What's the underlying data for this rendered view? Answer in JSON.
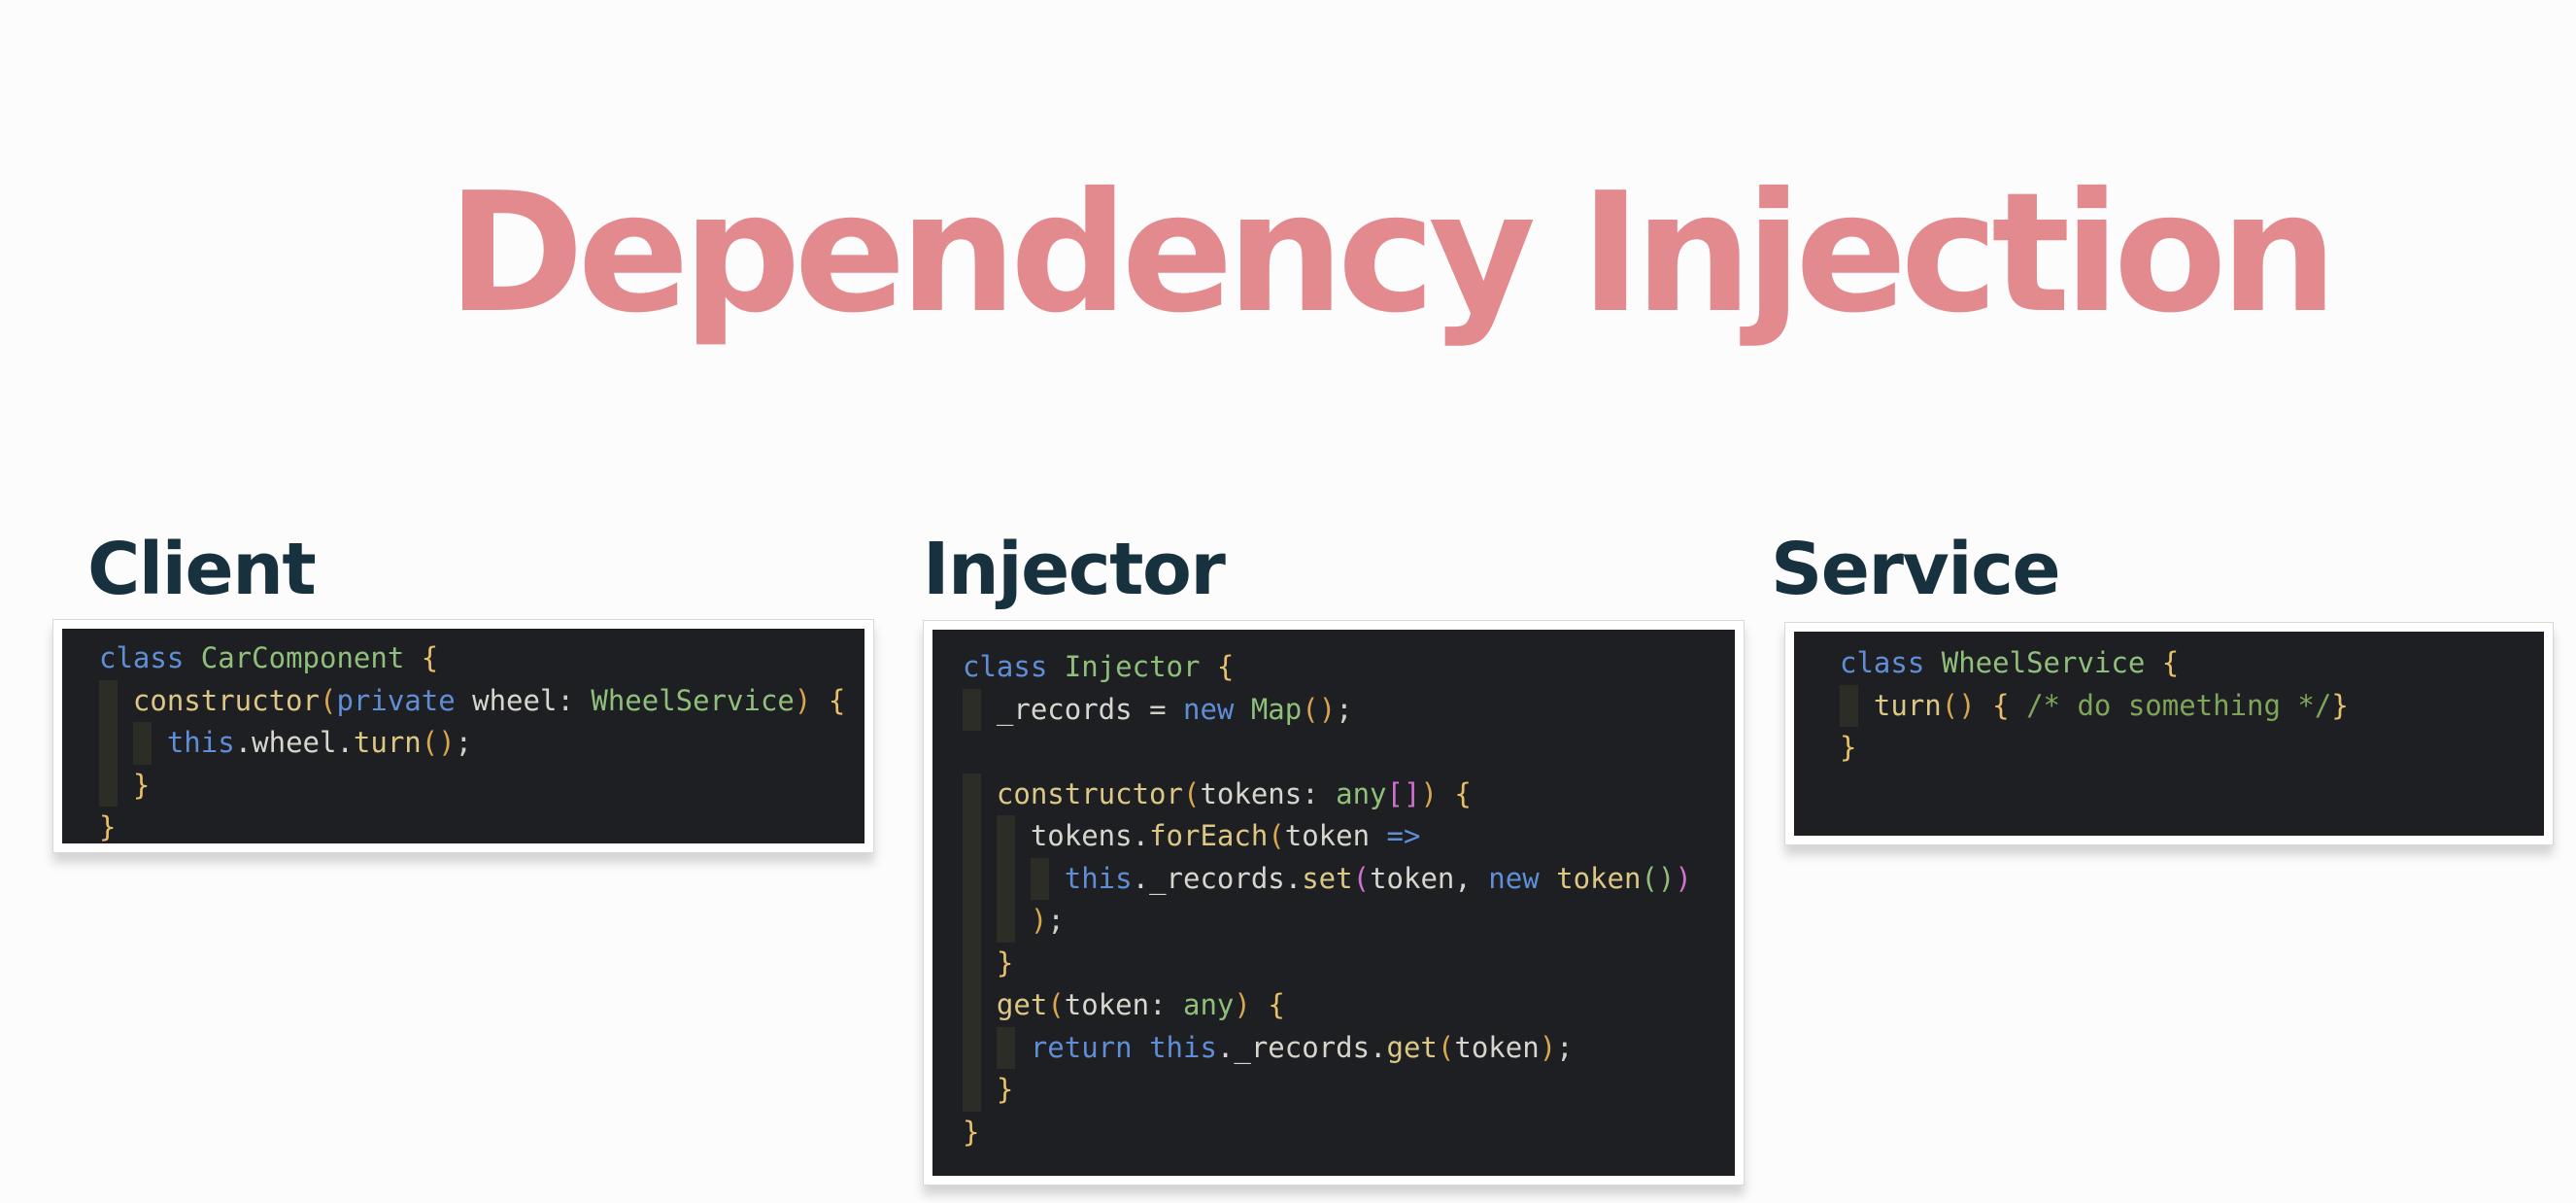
{
  "slide": {
    "title": "Dependency Injection"
  },
  "colors": {
    "title": "#e38a8f",
    "heading": "#17313f",
    "code_background": "#1e1f22",
    "keyword": "#5f8ed6",
    "class_name": "#8fbf7a",
    "method": "#dcc884",
    "identifier": "#d6d6cf",
    "brace": "#e8c06a",
    "paren": "#d9a64e",
    "bracket": "#d070d0",
    "comment": "#7fa55a",
    "punctuation": "#cfcfc8"
  },
  "sections": [
    {
      "heading": "Client",
      "code_lines": [
        [
          {
            "text": "class ",
            "kind": "keyword"
          },
          {
            "text": "CarComponent",
            "kind": "class_name"
          },
          {
            "text": " ",
            "kind": "identifier"
          },
          {
            "text": "{",
            "kind": "brace"
          }
        ],
        [
          {
            "text": "  ",
            "kind": "identifier"
          },
          {
            "text": "constructor",
            "kind": "method"
          },
          {
            "text": "(",
            "kind": "paren"
          },
          {
            "text": "private ",
            "kind": "keyword"
          },
          {
            "text": "wheel",
            "kind": "identifier"
          },
          {
            "text": ": ",
            "kind": "punctuation"
          },
          {
            "text": "WheelService",
            "kind": "class_name"
          },
          {
            "text": ")",
            "kind": "paren"
          },
          {
            "text": " ",
            "kind": "identifier"
          },
          {
            "text": "{",
            "kind": "brace"
          }
        ],
        [
          {
            "text": "    ",
            "kind": "identifier"
          },
          {
            "text": "this",
            "kind": "keyword"
          },
          {
            "text": ".wheel.",
            "kind": "identifier"
          },
          {
            "text": "turn",
            "kind": "method"
          },
          {
            "text": "()",
            "kind": "paren"
          },
          {
            "text": ";",
            "kind": "punctuation"
          }
        ],
        [
          {
            "text": "  ",
            "kind": "identifier"
          },
          {
            "text": "}",
            "kind": "brace"
          }
        ],
        [
          {
            "text": "}",
            "kind": "brace"
          }
        ]
      ]
    },
    {
      "heading": "Injector",
      "code_lines": [
        [
          {
            "text": "class ",
            "kind": "keyword"
          },
          {
            "text": "Injector",
            "kind": "class_name"
          },
          {
            "text": " ",
            "kind": "identifier"
          },
          {
            "text": "{",
            "kind": "brace"
          }
        ],
        [
          {
            "text": "  ",
            "kind": "identifier"
          },
          {
            "text": "_records",
            "kind": "identifier"
          },
          {
            "text": " = ",
            "kind": "punctuation"
          },
          {
            "text": "new ",
            "kind": "keyword"
          },
          {
            "text": "Map",
            "kind": "class_name"
          },
          {
            "text": "()",
            "kind": "paren"
          },
          {
            "text": ";",
            "kind": "punctuation"
          }
        ],
        [
          {
            "text": "",
            "kind": "identifier"
          }
        ],
        [
          {
            "text": "  ",
            "kind": "identifier"
          },
          {
            "text": "constructor",
            "kind": "method"
          },
          {
            "text": "(",
            "kind": "paren"
          },
          {
            "text": "tokens",
            "kind": "identifier"
          },
          {
            "text": ": ",
            "kind": "punctuation"
          },
          {
            "text": "any",
            "kind": "class_name"
          },
          {
            "text": "[]",
            "kind": "bracket"
          },
          {
            "text": ")",
            "kind": "paren"
          },
          {
            "text": " ",
            "kind": "identifier"
          },
          {
            "text": "{",
            "kind": "brace"
          }
        ],
        [
          {
            "text": "    ",
            "kind": "identifier"
          },
          {
            "text": "tokens.",
            "kind": "identifier"
          },
          {
            "text": "forEach",
            "kind": "method"
          },
          {
            "text": "(",
            "kind": "paren"
          },
          {
            "text": "token",
            "kind": "identifier"
          },
          {
            "text": " =>",
            "kind": "keyword"
          }
        ],
        [
          {
            "text": "      ",
            "kind": "identifier"
          },
          {
            "text": "this",
            "kind": "keyword"
          },
          {
            "text": "._records.",
            "kind": "identifier"
          },
          {
            "text": "set",
            "kind": "method"
          },
          {
            "text": "(",
            "kind": "bracket"
          },
          {
            "text": "token, ",
            "kind": "identifier"
          },
          {
            "text": "new ",
            "kind": "keyword"
          },
          {
            "text": "token",
            "kind": "method"
          },
          {
            "text": "()",
            "kind": "class_name"
          },
          {
            "text": ")",
            "kind": "bracket"
          }
        ],
        [
          {
            "text": "    ",
            "kind": "identifier"
          },
          {
            "text": ")",
            "kind": "paren"
          },
          {
            "text": ";",
            "kind": "punctuation"
          }
        ],
        [
          {
            "text": "  ",
            "kind": "identifier"
          },
          {
            "text": "}",
            "kind": "brace"
          }
        ],
        [
          {
            "text": "  ",
            "kind": "identifier"
          },
          {
            "text": "get",
            "kind": "method"
          },
          {
            "text": "(",
            "kind": "paren"
          },
          {
            "text": "token",
            "kind": "identifier"
          },
          {
            "text": ": ",
            "kind": "punctuation"
          },
          {
            "text": "any",
            "kind": "class_name"
          },
          {
            "text": ")",
            "kind": "paren"
          },
          {
            "text": " ",
            "kind": "identifier"
          },
          {
            "text": "{",
            "kind": "brace"
          }
        ],
        [
          {
            "text": "    ",
            "kind": "identifier"
          },
          {
            "text": "return ",
            "kind": "keyword"
          },
          {
            "text": "this",
            "kind": "keyword"
          },
          {
            "text": "._records.",
            "kind": "identifier"
          },
          {
            "text": "get",
            "kind": "method"
          },
          {
            "text": "(",
            "kind": "paren"
          },
          {
            "text": "token",
            "kind": "identifier"
          },
          {
            "text": ")",
            "kind": "paren"
          },
          {
            "text": ";",
            "kind": "punctuation"
          }
        ],
        [
          {
            "text": "  ",
            "kind": "identifier"
          },
          {
            "text": "}",
            "kind": "brace"
          }
        ],
        [
          {
            "text": "}",
            "kind": "brace"
          }
        ]
      ]
    },
    {
      "heading": "Service",
      "code_lines": [
        [
          {
            "text": "class ",
            "kind": "keyword"
          },
          {
            "text": "WheelService",
            "kind": "class_name"
          },
          {
            "text": " ",
            "kind": "identifier"
          },
          {
            "text": "{",
            "kind": "brace"
          }
        ],
        [
          {
            "text": "  ",
            "kind": "identifier"
          },
          {
            "text": "turn",
            "kind": "method"
          },
          {
            "text": "()",
            "kind": "paren"
          },
          {
            "text": " ",
            "kind": "identifier"
          },
          {
            "text": "{",
            "kind": "brace"
          },
          {
            "text": " /* do something */",
            "kind": "comment"
          },
          {
            "text": "}",
            "kind": "brace"
          }
        ],
        [
          {
            "text": "}",
            "kind": "brace"
          }
        ]
      ]
    }
  ]
}
